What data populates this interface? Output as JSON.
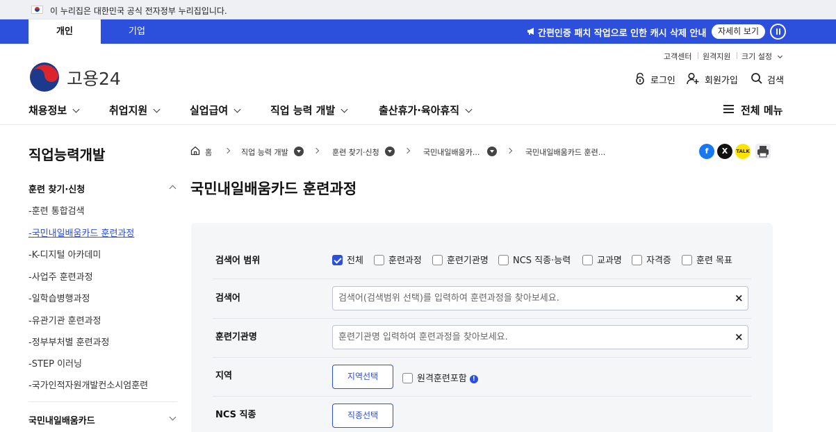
{
  "gov_banner": {
    "text": "이 누리집은 대한민국 공식 전자정부 누리집입니다."
  },
  "top_tabs": [
    {
      "label": "개인"
    },
    {
      "label": "기업"
    }
  ],
  "notice": {
    "text": "간편인증 패치 작업으로 인한 캐시 삭제 안내",
    "detail_label": "자세히 보기"
  },
  "utility": {
    "customer_center": "고객센터",
    "remote_support": "원격지원",
    "font_size": "크기 설정"
  },
  "logo": {
    "text": "고용24"
  },
  "header_links": {
    "login": "로그인",
    "signup": "회원가입",
    "search": "검색"
  },
  "gnb": [
    {
      "label": "채용정보"
    },
    {
      "label": "취업지원"
    },
    {
      "label": "실업급여"
    },
    {
      "label": "직업 능력 개발"
    },
    {
      "label": "출산휴가·육아휴직"
    }
  ],
  "menu_all": "전체 메뉴",
  "sidebar": {
    "title": "직업능력개발",
    "group1": "훈련 찾기·신청",
    "items": [
      "-훈련 통합검색",
      "-국민내일배움카드 훈련과정",
      "-K-디지털 아카데미",
      "-사업주 훈련과정",
      "-일학습병행과정",
      "-유관기관 훈련과정",
      "-정부부처별 훈련과정",
      "-STEP 이러닝",
      "-국가인적자원개발컨소시엄훈련"
    ],
    "group2": "국민내일배움카드"
  },
  "breadcrumb": [
    "홈",
    "직업 능력 개발",
    "훈련 찾기·신청",
    "국민내일배움카...",
    "국민내일배움카드 훈련..."
  ],
  "share": {
    "facebook": "f",
    "x": "X",
    "kakao": "TALK"
  },
  "page_title": "국민내일배움카드 훈련과정",
  "search": {
    "scope_label": "검색어 범위",
    "scope_options": [
      {
        "label": "전체",
        "checked": true
      },
      {
        "label": "훈련과정",
        "checked": false
      },
      {
        "label": "훈련기관명",
        "checked": false
      },
      {
        "label": "NCS 직종·능력",
        "checked": false
      },
      {
        "label": "교과명",
        "checked": false
      },
      {
        "label": "자격증",
        "checked": false
      },
      {
        "label": "훈련 목표",
        "checked": false
      }
    ],
    "keyword_label": "검색어",
    "keyword_placeholder": "검색어(검색범위 선택)를 입력하여 훈련과정을 찾아보세요.",
    "org_label": "훈련기관명",
    "org_placeholder": "훈련기관명 입력하여 훈련과정을 찾아보세요.",
    "region_label": "지역",
    "region_button": "지역선택",
    "remote_label": "원격훈련포함",
    "remote_info": "!",
    "ncs_label": "NCS 직종",
    "ncs_button": "직종선택",
    "clear_glyph": "×"
  },
  "colors": {
    "primary": "#2c4fdc",
    "panel": "#f5f6f8"
  }
}
